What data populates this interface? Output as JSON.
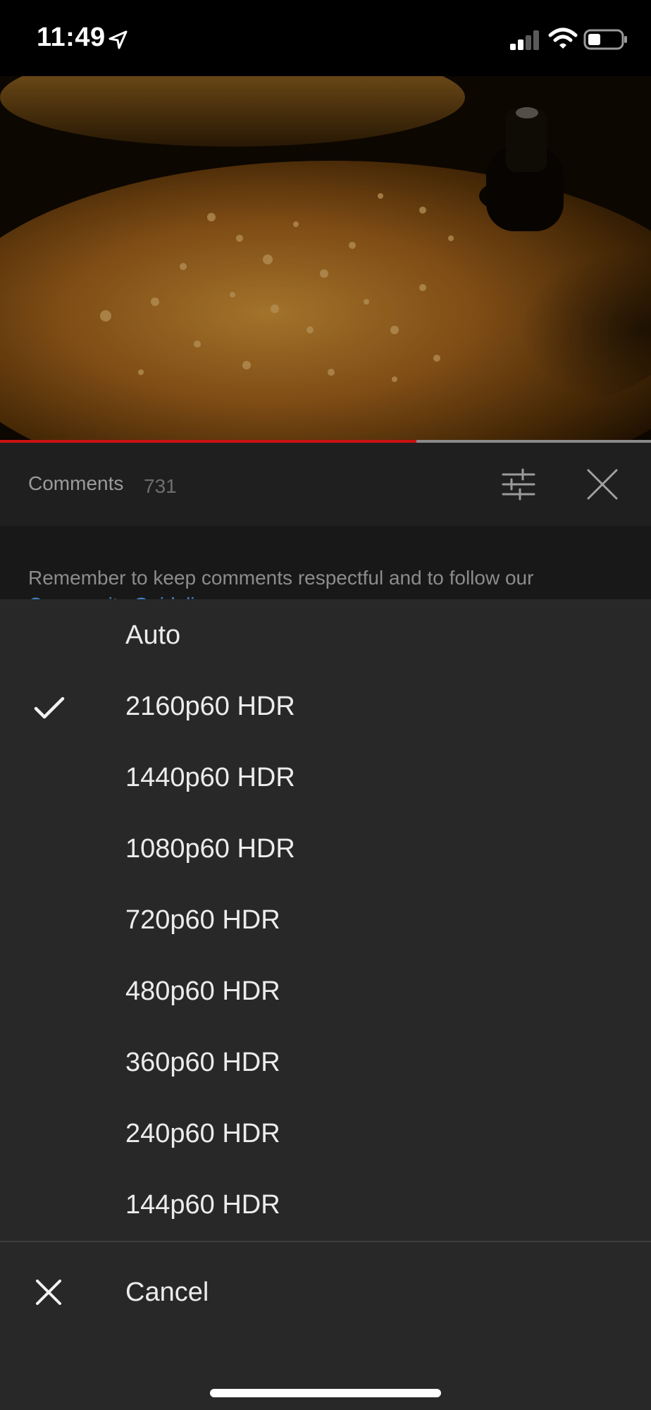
{
  "status_bar": {
    "time": "11:49",
    "location_icon": "location-arrow-icon",
    "signal_icon": "cellular-signal-icon",
    "wifi_icon": "wifi-icon",
    "battery_icon": "battery-icon"
  },
  "video": {
    "progress_fraction": 0.64,
    "played_color": "#cc1111"
  },
  "comments": {
    "title": "Comments",
    "count": "731",
    "guideline_text": "Remember to keep comments respectful and to follow our",
    "guideline_link": "Community Guidelines",
    "filter_icon": "sliders-icon",
    "close_icon": "close-icon"
  },
  "quality_menu": {
    "selected_index": 1,
    "options": [
      {
        "label": "Auto"
      },
      {
        "label": "2160p60 HDR"
      },
      {
        "label": "1440p60 HDR"
      },
      {
        "label": "1080p60 HDR"
      },
      {
        "label": "720p60 HDR"
      },
      {
        "label": "480p60 HDR"
      },
      {
        "label": "360p60 HDR"
      },
      {
        "label": "240p60 HDR"
      },
      {
        "label": "144p60 HDR"
      }
    ],
    "cancel_label": "Cancel",
    "check_icon": "checkmark-icon",
    "cancel_icon": "close-icon"
  }
}
